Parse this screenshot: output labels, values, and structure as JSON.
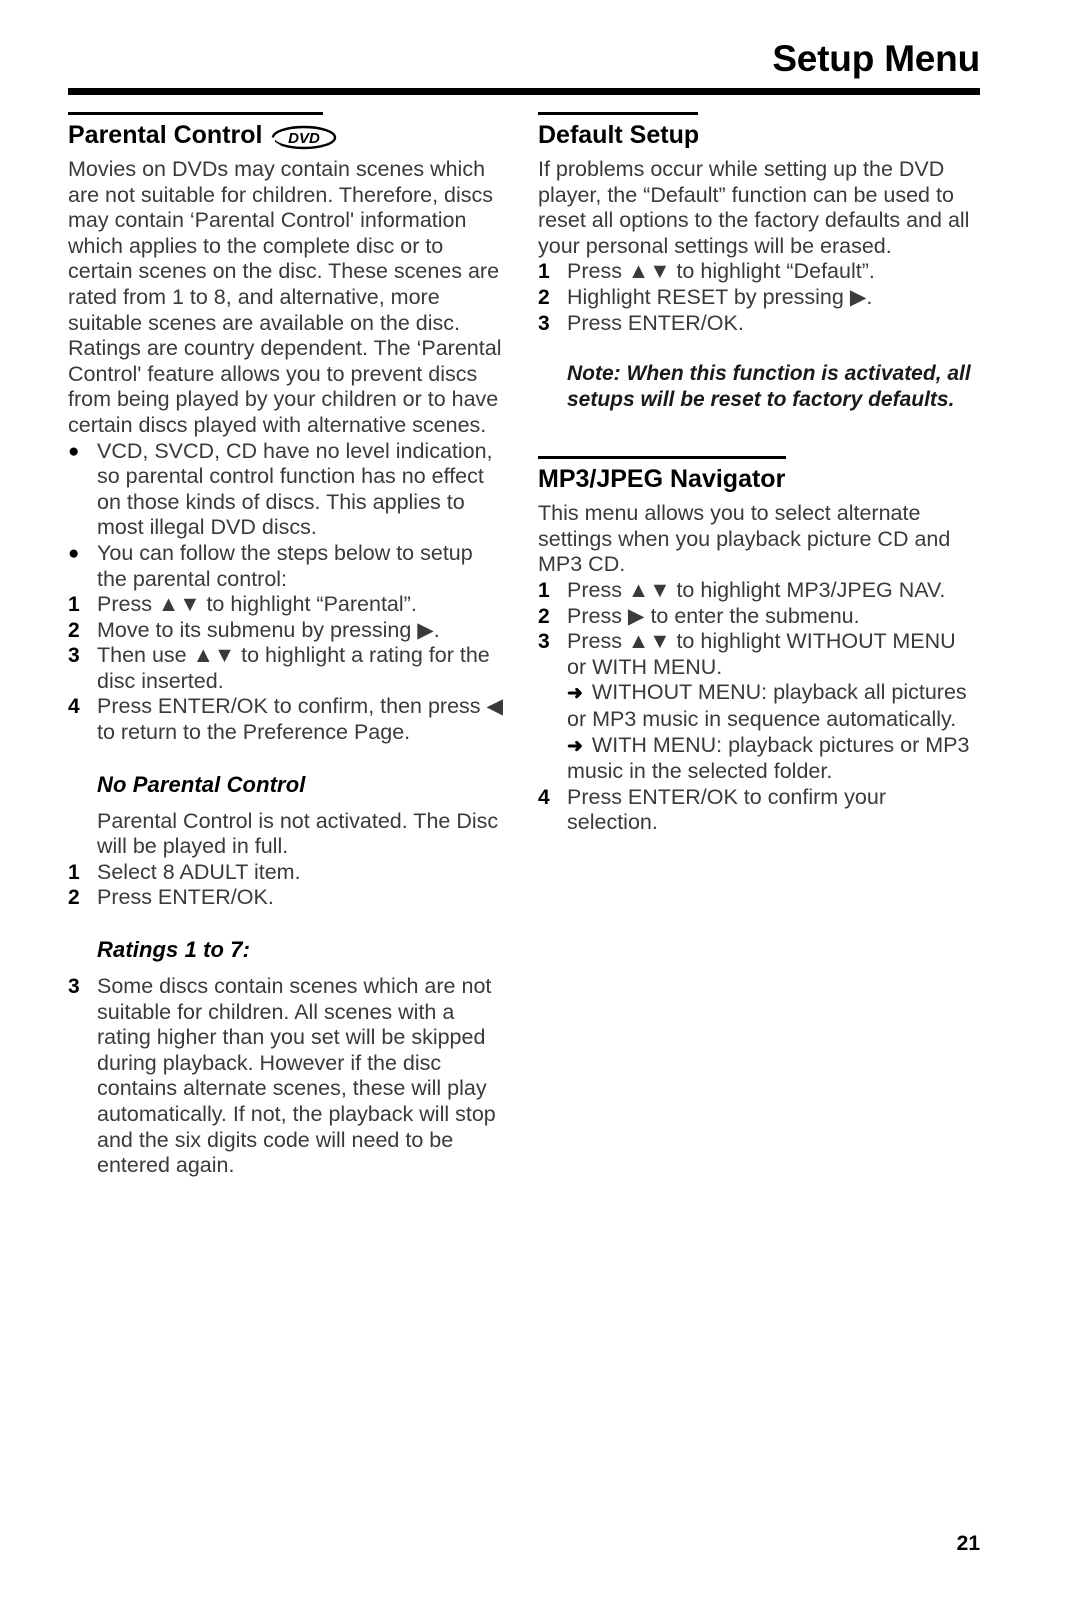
{
  "header": {
    "title": "Setup Menu"
  },
  "page_number": "21",
  "left_column": {
    "section_title": "Parental Control",
    "badge": "DVD",
    "intro": "Movies on DVDs may contain scenes which are not suitable for children. Therefore, discs may contain ‘Parental Control' information which applies to the complete disc or to certain scenes on the disc. These scenes are rated from 1 to 8, and alternative, more suitable scenes are available on the disc. Ratings are country dependent. The ‘Parental Control' feature allows you to prevent discs from being played by your children or to have certain discs played with alternative scenes.",
    "bullets": [
      {
        "marker": "●",
        "text": "VCD, SVCD, CD have no level indication, so parental control function has no effect on those kinds of discs. This applies to most illegal DVD discs."
      },
      {
        "marker": "●",
        "text": "You can follow the steps below to setup the parental control:"
      }
    ],
    "steps": [
      {
        "num": "1",
        "text": "Press ▲▼ to highlight “Parental”."
      },
      {
        "num": "2",
        "text": "Move to its submenu by pressing ▶."
      },
      {
        "num": "3",
        "text": "Then use ▲▼ to highlight a rating for the disc inserted."
      },
      {
        "num": "4",
        "text": "Press ENTER/OK to confirm, then press ◀ to return to the Preference Page."
      }
    ],
    "no_parental": {
      "heading": "No Parental Control",
      "text": "Parental Control is not activated. The Disc will be played in full.",
      "steps": [
        {
          "num": "1",
          "text": "Select 8 ADULT item."
        },
        {
          "num": "2",
          "text": "Press ENTER/OK."
        }
      ]
    },
    "ratings": {
      "heading": "Ratings 1 to 7:",
      "steps": [
        {
          "num": "3",
          "text": "Some discs contain scenes which are not suitable for children. All scenes with a rating higher than you set will be skipped during playback. However if the disc contains alternate scenes, these will play automatically. If not, the playback will stop and the six digits code will need to be entered again."
        }
      ]
    }
  },
  "right_column": {
    "default_setup": {
      "section_title": "Default Setup",
      "intro": "If problems occur while setting up the DVD player, the “Default” function can be used to reset all options to the factory defaults and all your personal settings will be erased.",
      "steps": [
        {
          "num": "1",
          "text": "Press ▲▼ to highlight “Default”."
        },
        {
          "num": "2",
          "text": "Highlight RESET by pressing ▶."
        },
        {
          "num": "3",
          "text": "Press ENTER/OK."
        }
      ],
      "note": "Note: When this function is activated, all setups will be reset to factory defaults."
    },
    "mp3_navigator": {
      "section_title": "MP3/JPEG Navigator",
      "intro": "This menu allows you to select alternate settings when you playback picture CD and MP3 CD.",
      "steps": [
        {
          "num": "1",
          "text": "Press ▲▼ to highlight MP3/JPEG NAV."
        },
        {
          "num": "2",
          "text": "Press ▶ to enter the submenu."
        },
        {
          "num": "3",
          "text": "Press ▲▼ to highlight WITHOUT MENU or WITH MENU."
        }
      ],
      "sub_items": [
        {
          "arrow": "➜",
          "text": "WITHOUT MENU: playback all pictures or MP3 music in sequence automatically."
        },
        {
          "arrow": "➜",
          "text": "WITH MENU: playback pictures or MP3 music in the selected folder."
        }
      ],
      "final_step": {
        "num": "4",
        "text": "Press ENTER/OK to confirm your selection."
      }
    }
  }
}
